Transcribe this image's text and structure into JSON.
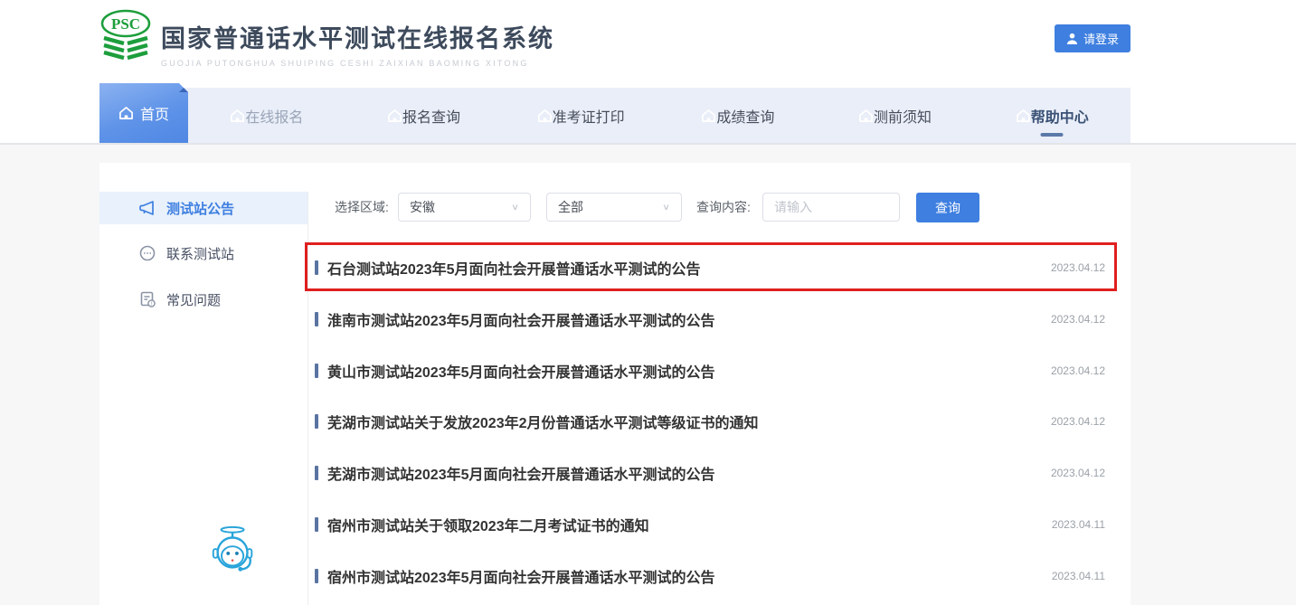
{
  "header": {
    "logo_text": "PSC",
    "title": "国家普通话水平测试在线报名系统",
    "subtitle": "GUOJIA PUTONGHUA SHUIPING CESHI ZAIXIAN BAOMING XITONG",
    "login_label": "请登录"
  },
  "nav": {
    "items": [
      {
        "key": "home",
        "label": "首页",
        "active": true
      },
      {
        "key": "online-registration",
        "label": "在线报名",
        "muted": true
      },
      {
        "key": "registration-query",
        "label": "报名查询"
      },
      {
        "key": "ticket-print",
        "label": "准考证打印"
      },
      {
        "key": "score-query",
        "label": "成绩查询"
      },
      {
        "key": "pretest-notes",
        "label": "测前须知"
      },
      {
        "key": "help-center",
        "label": "帮助中心",
        "current": true
      }
    ]
  },
  "sidebar": {
    "items": [
      {
        "key": "station-announcements",
        "label": "测试站公告",
        "icon": "megaphone-icon",
        "active": true
      },
      {
        "key": "contact-station",
        "label": "联系测试站",
        "icon": "chat-icon",
        "active": false
      },
      {
        "key": "faq",
        "label": "常见问题",
        "icon": "faq-doc-icon",
        "active": false
      }
    ]
  },
  "filters": {
    "region_label": "选择区域:",
    "region_value": "安徽",
    "category_value": "全部",
    "query_label": "查询内容:",
    "query_placeholder": "请输入",
    "search_button": "查询"
  },
  "announcements": [
    {
      "title": "石台测试站2023年5月面向社会开展普通话水平测试的公告",
      "date": "2023.04.12",
      "highlighted": true
    },
    {
      "title": "淮南市测试站2023年5月面向社会开展普通话水平测试的公告",
      "date": "2023.04.12",
      "highlighted": false
    },
    {
      "title": "黄山市测试站2023年5月面向社会开展普通话水平测试的公告",
      "date": "2023.04.12",
      "highlighted": false
    },
    {
      "title": "芜湖市测试站关于发放2023年2月份普通话水平测试等级证书的通知",
      "date": "2023.04.12",
      "highlighted": false
    },
    {
      "title": "芜湖市测试站2023年5月面向社会开展普通话水平测试的公告",
      "date": "2023.04.12",
      "highlighted": false
    },
    {
      "title": "宿州市测试站关于领取2023年二月考试证书的通知",
      "date": "2023.04.11",
      "highlighted": false
    },
    {
      "title": "宿州市测试站2023年5月面向社会开展普通话水平测试的公告",
      "date": "2023.04.11",
      "highlighted": false
    }
  ],
  "colors": {
    "accent_blue": "#3e7fe0",
    "nav_bg": "#e9eef8",
    "active_sidebar_bg": "#e8f1fc",
    "highlight_red": "#e01f1f",
    "logo_green": "#1d9e3c",
    "robot_blue": "#29a4da",
    "marker_blue_gray": "#5a74a2",
    "page_bg": "#f7f7f8"
  }
}
